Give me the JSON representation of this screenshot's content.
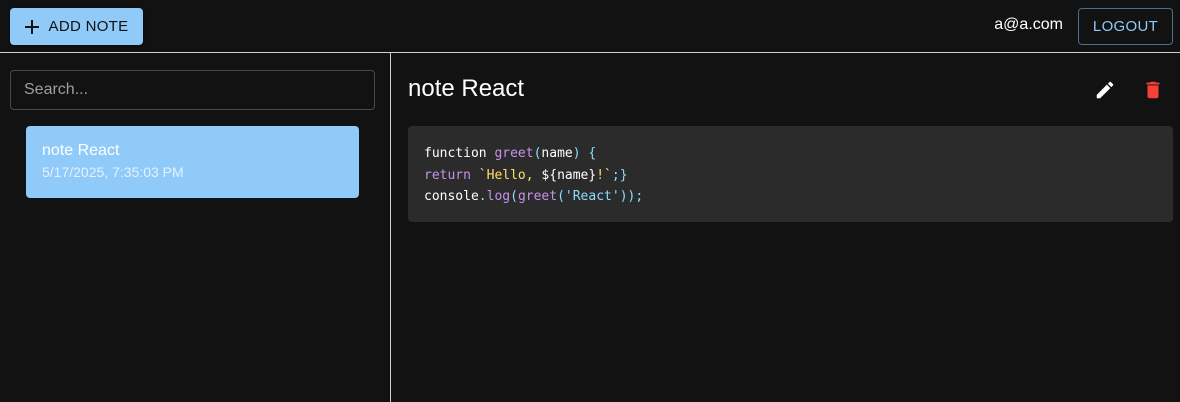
{
  "appbar": {
    "add_label": "ADD NOTE",
    "user_email": "a@a.com",
    "logout_label": "LOGOUT"
  },
  "sidebar": {
    "search_placeholder": "Search...",
    "notes": [
      {
        "title": "note React",
        "date": "5/17/2025, 7:35:03 PM"
      }
    ]
  },
  "note": {
    "title": "note React",
    "code": {
      "line1": {
        "kw": "function",
        "name": "greet",
        "open": "(",
        "param": "name",
        "close": ")",
        "brace": "{"
      },
      "line2": {
        "kw": "return",
        "tick_open": "`",
        "hello": "Hello,",
        "interp_open": "${",
        "var": "name",
        "interp_close": "}",
        "bang": "!",
        "tick_close": "`",
        "end": ";}"
      },
      "line3": {
        "obj": "console",
        "dot": ".",
        "method": "log",
        "open1": "(",
        "call": "greet",
        "open2": "(",
        "arg": "'React'",
        "close": "));"
      }
    }
  },
  "icons": {
    "add": "plus-icon",
    "edit": "pencil-icon",
    "delete": "trash-icon"
  },
  "colors": {
    "background": "#121212",
    "accent": "#90caf9",
    "delete": "#f44336",
    "code_bg": "#2b2b2b"
  }
}
